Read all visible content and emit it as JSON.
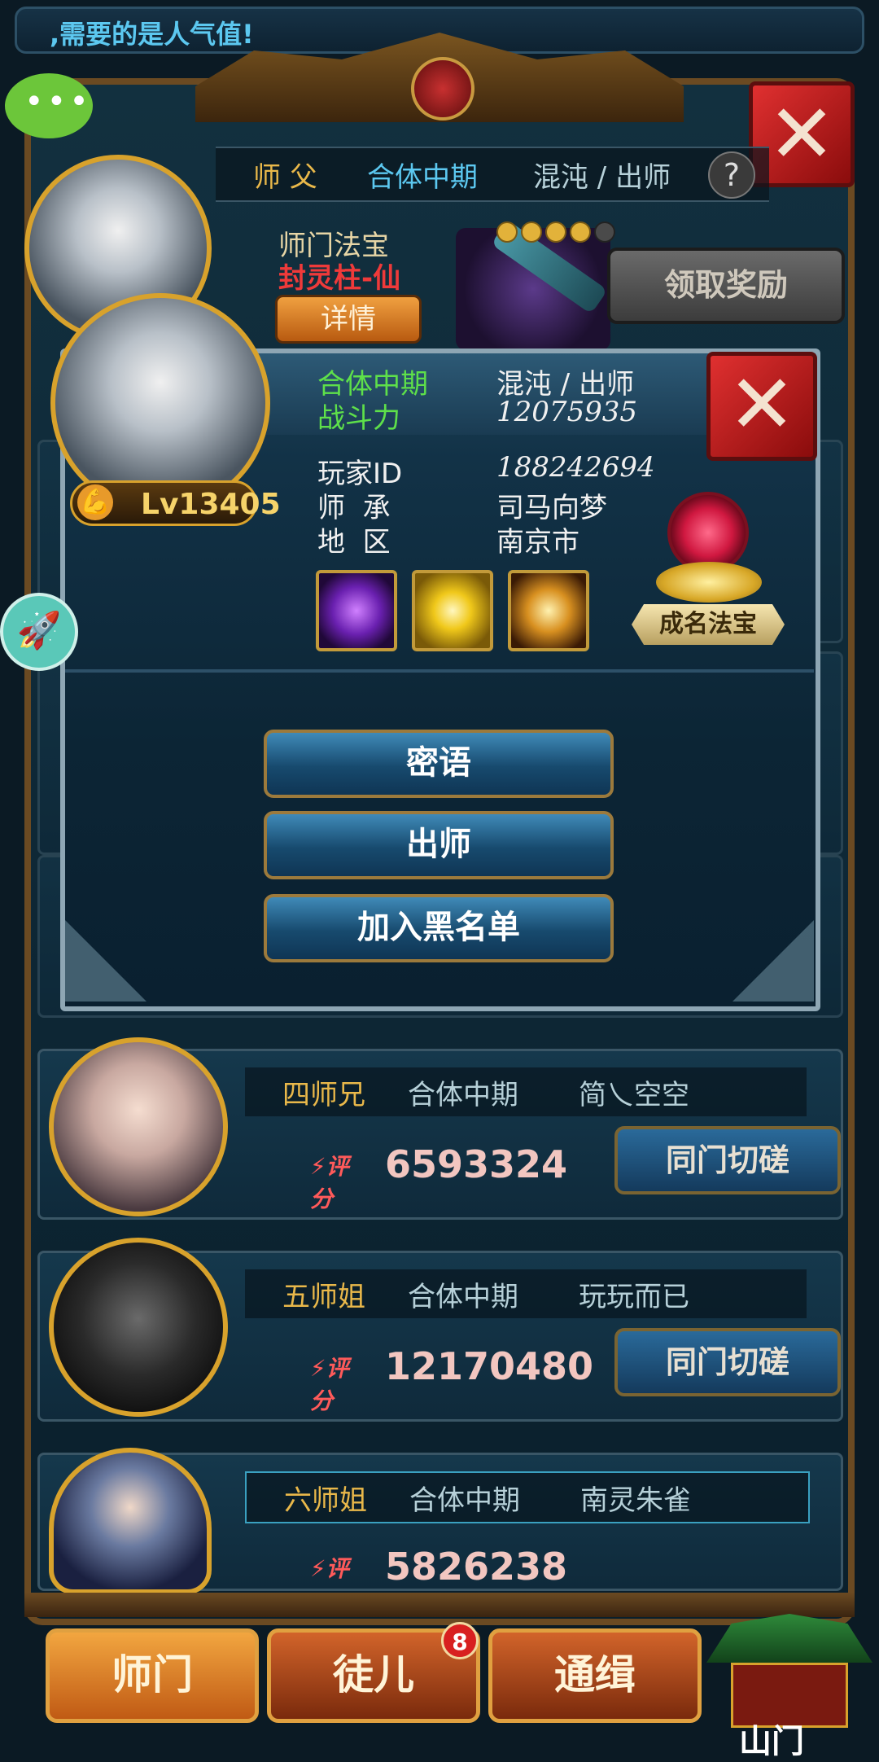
{
  "marquee": {
    "text": ",需要的是人气值!"
  },
  "master": {
    "role": "师 父",
    "realm": "合体中期",
    "name": "混沌 / 出师",
    "help": "?",
    "treasure_label": "师门法宝",
    "treasure_name": "封灵柱-仙",
    "detail_button": "详情",
    "stars_filled": 4,
    "stars_total": 5,
    "reward_button": "领取奖励"
  },
  "popup": {
    "realm": "合体中期",
    "name": "混沌 / 出师",
    "power_label": "战斗力",
    "power_value": "12075935",
    "level": "Lv13405",
    "info": [
      {
        "label": "玩家ID",
        "value": "188242694"
      },
      {
        "label": "师  承",
        "value": "司马向梦"
      },
      {
        "label": "地  区",
        "value": "南京市"
      }
    ],
    "fame_label": "成名法宝",
    "buttons": [
      "密语",
      "出师",
      "加入黑名单"
    ]
  },
  "rows": [
    {
      "rank": "四师兄",
      "realm": "合体中期",
      "name": "简乀空空",
      "score_label": "评分",
      "score": "6593324",
      "button": "同门切磋"
    },
    {
      "rank": "五师姐",
      "realm": "合体中期",
      "name": "玩玩而已",
      "score_label": "评分",
      "score": "12170480",
      "button": "同门切磋"
    },
    {
      "rank": "六师姐",
      "realm": "合体中期",
      "name": "南灵朱雀",
      "score_label": "评分",
      "score": "5826238",
      "button": ""
    }
  ],
  "tabs": [
    "师门",
    "徒儿",
    "通缉"
  ],
  "tab_badge": "8",
  "gate_label": "山门",
  "icons": {
    "chat": "chat-bubble-icon",
    "close": "close-x-icon",
    "rocket": "rocket-icon",
    "score": "score-icon"
  },
  "colors": {
    "accent_gold": "#d8a22c",
    "realm_green": "#5ee04a",
    "close_red": "#e03030"
  }
}
